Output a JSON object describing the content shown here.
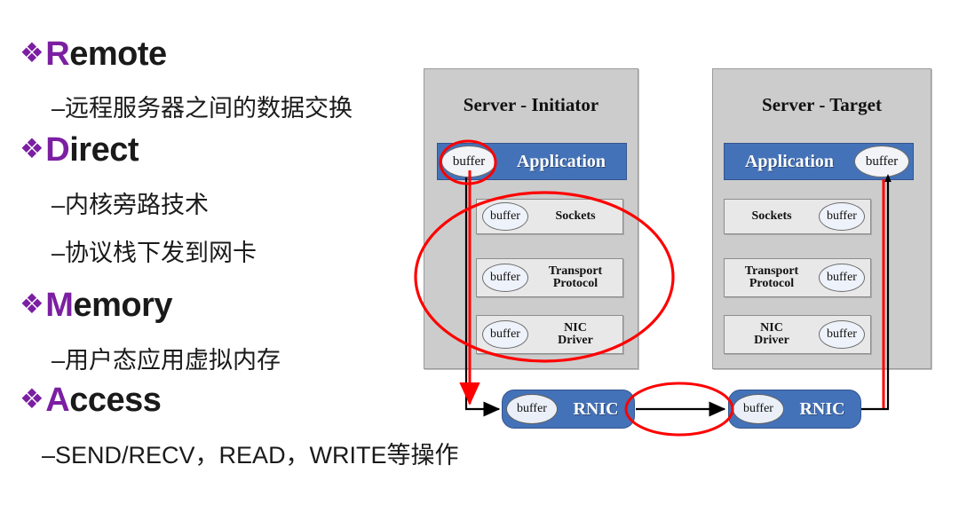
{
  "slide": {
    "bullets": [
      {
        "marker": "❖",
        "cap": "R",
        "rest": "emote",
        "subs": [
          "–远程服务器之间的数据交换"
        ]
      },
      {
        "marker": "❖",
        "cap": "D",
        "rest": "irect",
        "subs": [
          "–内核旁路技术",
          "–协议栈下发到网卡"
        ]
      },
      {
        "marker": "❖",
        "cap": "M",
        "rest": "emory",
        "subs": [
          "–用户态应用虚拟内存"
        ]
      },
      {
        "marker": "❖",
        "cap": "A",
        "rest": "ccess",
        "subs": [
          "–SEND/RECV，READ，WRITE等操作"
        ]
      }
    ],
    "accent_color": "#7B1FA2",
    "text_color": "#1a1a1a"
  },
  "diagram": {
    "buffer_label": "buffer",
    "colors": {
      "server_bg": "#CCCCCC",
      "application_blue": "#4472B8",
      "layer_gray": "#E8E8E8",
      "buffer_fill": "#EEF2FA",
      "highlight_red": "#FF0000",
      "connector_black": "#000000"
    },
    "initiator": {
      "title": "Server - Initiator",
      "layers": [
        {
          "label": "Application",
          "style": "app",
          "buffer_side": "left"
        },
        {
          "label": "Sockets",
          "style": "plain",
          "buffer_side": "left"
        },
        {
          "label": "Transport\nProtocol",
          "style": "plain",
          "buffer_side": "left"
        },
        {
          "label": "NIC\nDriver",
          "style": "plain",
          "buffer_side": "left"
        }
      ],
      "nic": {
        "label": "RNIC",
        "buffer_side": "left"
      }
    },
    "target": {
      "title": "Server - Target",
      "layers": [
        {
          "label": "Application",
          "style": "app",
          "buffer_side": "right"
        },
        {
          "label": "Sockets",
          "style": "plain",
          "buffer_side": "right"
        },
        {
          "label": "Transport\nProtocol",
          "style": "plain",
          "buffer_side": "right"
        },
        {
          "label": "NIC\nDriver",
          "style": "plain",
          "buffer_side": "right"
        }
      ],
      "nic": {
        "label": "RNIC",
        "buffer_side": "right"
      }
    },
    "annotations": [
      {
        "name": "highlight-initiator-app-buffer",
        "shape": "ellipse"
      },
      {
        "name": "highlight-initiator-kernel-stack",
        "shape": "ellipse"
      },
      {
        "name": "highlight-network-link",
        "shape": "ellipse"
      },
      {
        "name": "rdma-bypass-path",
        "shape": "arrow"
      }
    ]
  }
}
